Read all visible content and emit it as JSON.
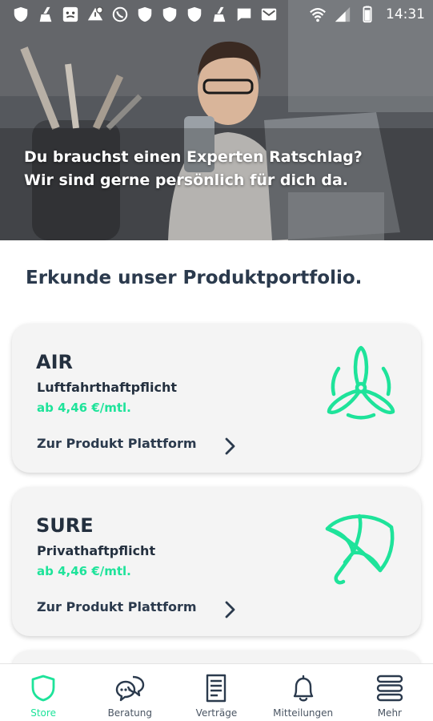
{
  "status_bar": {
    "time": "14:31",
    "left_icons": [
      "shield-icon",
      "shield-icon",
      "broom-icon",
      "face-icon",
      "alert-icon",
      "whatsapp-icon",
      "shield-icon",
      "shield-icon",
      "shield-icon",
      "shield-icon",
      "broom-icon",
      "message-icon",
      "mail-icon"
    ],
    "right_icons": [
      "wifi-icon",
      "signal-icon",
      "battery-icon"
    ]
  },
  "hero": {
    "line1": "Du brauchst einen Experten Ratschlag?",
    "line2": "Wir sind gerne persönlich für dich da."
  },
  "section_title": "Erkunde unser Produktportfolio.",
  "products": [
    {
      "name": "AIR",
      "subtitle": "Luftfahrthaftpflicht",
      "price": "ab 4,46 €/mtl.",
      "link": "Zur Produkt Plattform",
      "icon": "propeller-icon"
    },
    {
      "name": "SURE",
      "subtitle": "Privathaftpflicht",
      "price": "ab 4,46 €/mtl.",
      "link": "Zur Produkt Plattform",
      "icon": "umbrella-icon"
    }
  ],
  "nav": [
    {
      "label": "Store",
      "icon": "shield-icon",
      "active": true
    },
    {
      "label": "Beratung",
      "icon": "chat-bubbles-icon",
      "active": false
    },
    {
      "label": "Verträge",
      "icon": "document-icon",
      "active": false
    },
    {
      "label": "Mitteilungen",
      "icon": "bell-icon",
      "active": false
    },
    {
      "label": "Mehr",
      "icon": "menu-icon",
      "active": false
    }
  ],
  "colors": {
    "accent": "#1ee39a",
    "text_dark": "#24303f",
    "card_bg": "#f4f4f4"
  }
}
